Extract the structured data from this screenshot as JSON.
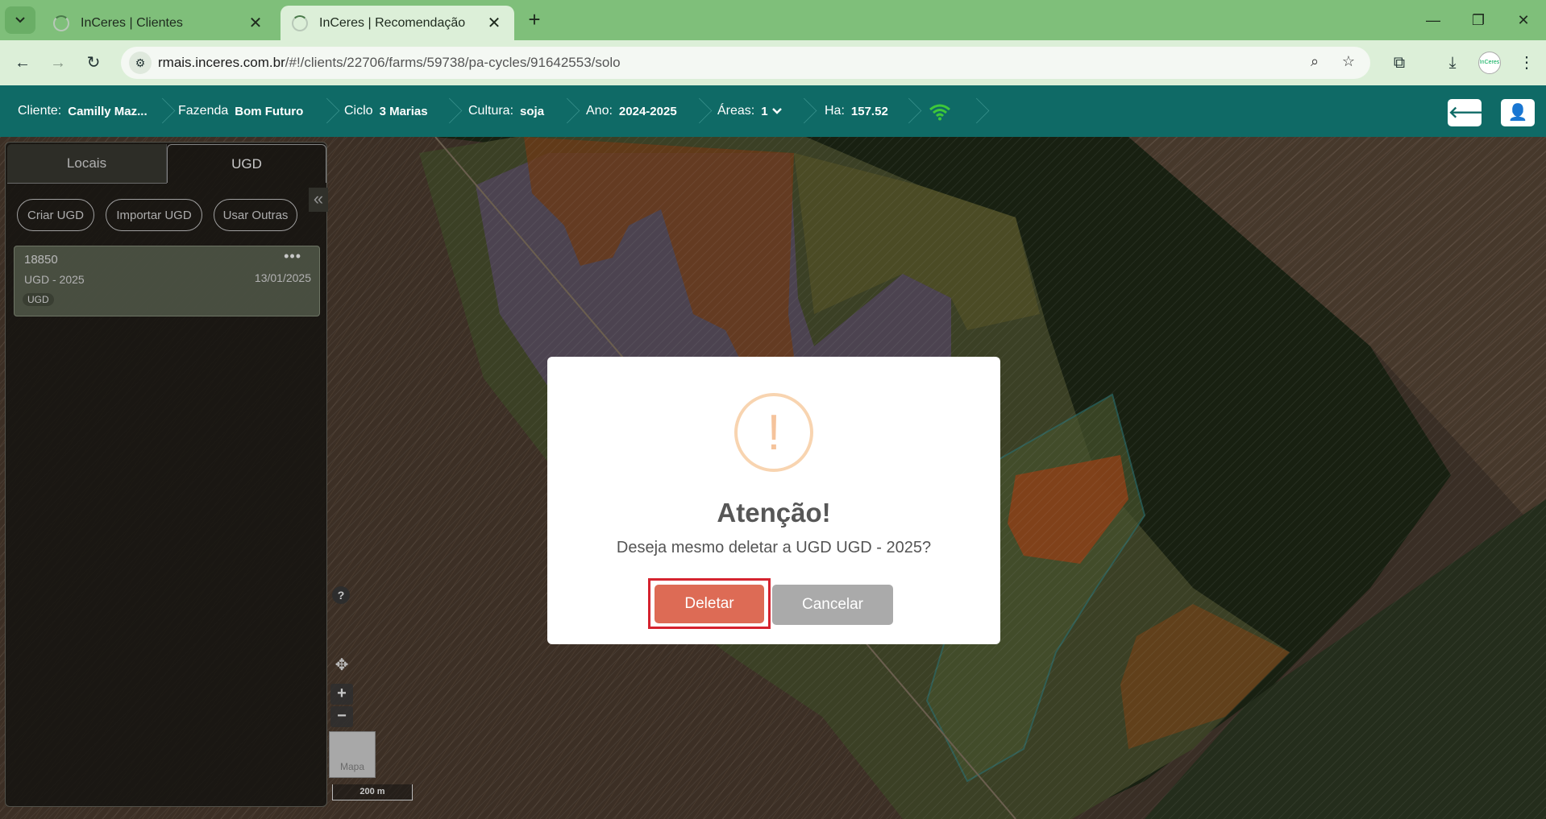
{
  "browser": {
    "tabs": [
      {
        "title": "InCeres | Clientes",
        "close": "✕"
      },
      {
        "title": "InCeres | Recomendação",
        "close": "✕"
      }
    ],
    "new_tab": "+",
    "window_controls": {
      "minimize": "—",
      "restore": "❐",
      "close": "✕"
    },
    "url_host": "rmais.inceres.com.br",
    "url_path": "/#!/clients/22706/farms/59738/pa-cycles/91642553/solo",
    "profile_text": "InCeres"
  },
  "header": {
    "cliente_label": "Cliente:",
    "cliente_value": "Camilly Maz...",
    "fazenda_label": "Fazenda",
    "fazenda_value": "Bom Futuro",
    "ciclo_label": "Ciclo",
    "ciclo_value": "3 Marias",
    "cultura_label": "Cultura:",
    "cultura_value": "soja",
    "ano_label": "Ano:",
    "ano_value": "2024-2025",
    "areas_label": "Áreas:",
    "areas_value": "1",
    "ha_label": "Ha:",
    "ha_value": "157.52",
    "back_icon": "🡐",
    "user_icon": "👤"
  },
  "panel": {
    "tab_locais": "Locais",
    "tab_ugd": "UGD",
    "collapse_icon": "«",
    "btn_criar": "Criar UGD",
    "btn_importar": "Importar UGD",
    "btn_usar": "Usar Outras",
    "card": {
      "number": "18850",
      "name": "UGD - 2025",
      "date": "13/01/2025",
      "tag": "UGD",
      "menu": "•••"
    }
  },
  "map": {
    "help": "?",
    "zoom_in": "+",
    "zoom_out": "−",
    "layer_label": "Mapa",
    "scale_label": "200 m"
  },
  "modal": {
    "icon": "!",
    "title": "Atenção!",
    "message": "Deseja mesmo deletar a UGD UGD - 2025?",
    "confirm": "Deletar",
    "cancel": "Cancelar"
  },
  "colors": {
    "tabbar": "#7fbf7a",
    "appbar": "#0f6a66",
    "delete_button": "#dd6b55",
    "cancel_button": "#aaaaaa",
    "warning": "#f5c39b"
  }
}
